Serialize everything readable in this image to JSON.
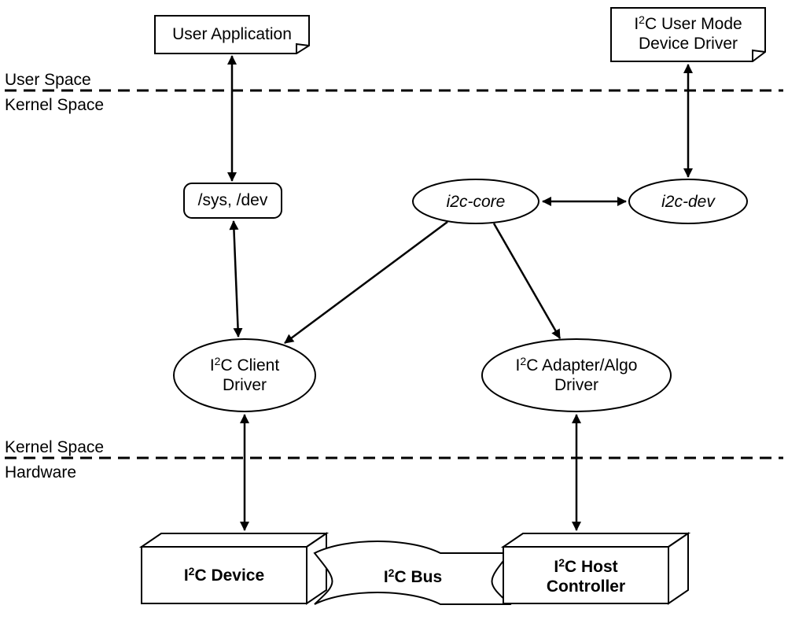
{
  "labels": {
    "user_space": "User Space",
    "kernel_space": "Kernel Space",
    "hardware": "Hardware"
  },
  "nodes": {
    "user_app": "User Application",
    "user_mode_driver_l1": "I²C User Mode",
    "user_mode_driver_l2": "Device Driver",
    "sys_dev": "/sys, /dev",
    "i2c_core": "i2c-core",
    "i2c_dev": "i2c-dev",
    "client_driver_l1": "I²C Client",
    "client_driver_l2": "Driver",
    "adapter_driver_l1": "I²C Adapter/Algo",
    "adapter_driver_l2": "Driver",
    "device": "I²C Device",
    "bus": "I²C Bus",
    "host_l1": "I²C Host",
    "host_l2": "Controller"
  }
}
